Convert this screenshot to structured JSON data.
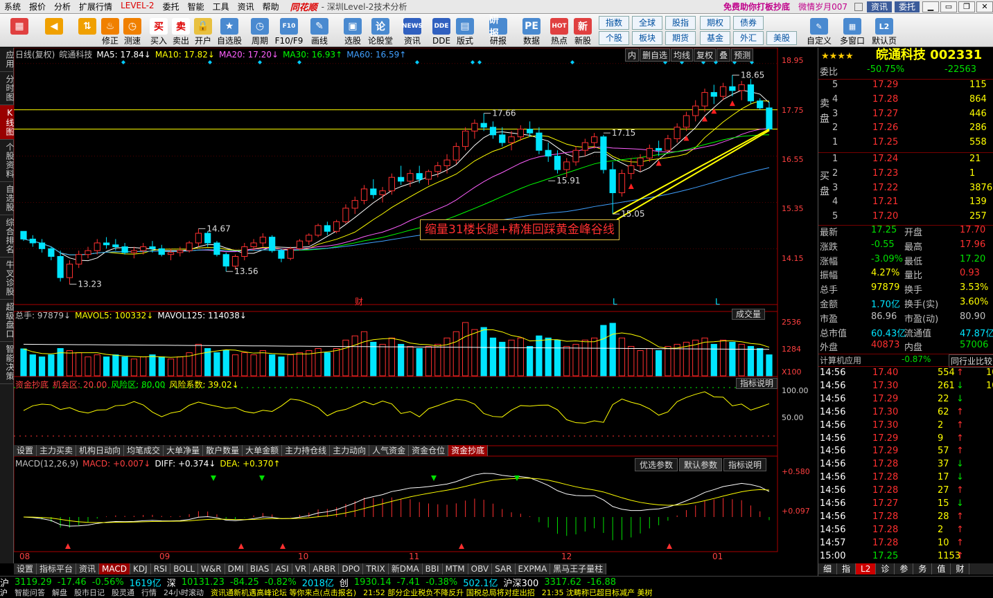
{
  "menu": {
    "items": [
      "系统",
      "报价",
      "分析",
      "扩展行情",
      "LEVEL-2",
      "委托",
      "智能",
      "工具",
      "资讯",
      "帮助"
    ],
    "logo": "同花顺",
    "title": "- 深圳Level-2技术分析",
    "promo": "免费助你打板抄底",
    "user": "微情岁月007",
    "buttons": [
      "资讯",
      "委托"
    ],
    "win": [
      "▁",
      "▭",
      "❐",
      "✕"
    ]
  },
  "toolbar": {
    "buttons": [
      {
        "label": "",
        "icon": "▦"
      },
      {
        "label": "",
        "icon": "◀"
      },
      {
        "label": "",
        "icon": "⇅"
      },
      {
        "label": "修正",
        "icon": "♨"
      },
      {
        "label": "测速",
        "icon": "◷"
      },
      {
        "label": "买入",
        "icon": "买"
      },
      {
        "label": "卖出",
        "icon": "卖"
      },
      {
        "label": "开户",
        "icon": "🔒"
      },
      {
        "label": "自选股",
        "icon": "★"
      },
      {
        "label": "周期",
        "icon": "◷"
      },
      {
        "label": "F10/F9",
        "icon": "F10"
      },
      {
        "label": "画线",
        "icon": "✎"
      },
      {
        "label": "选股",
        "icon": "▣"
      },
      {
        "label": "论股堂",
        "icon": "论"
      },
      {
        "label": "资讯",
        "icon": "NEWS"
      },
      {
        "label": "DDE",
        "icon": "DDE"
      },
      {
        "label": "版式",
        "icon": "▤"
      },
      {
        "label": "研报",
        "icon": "研报"
      },
      {
        "label": "数据",
        "icon": "PE"
      },
      {
        "label": "热点",
        "icon": "HOT"
      },
      {
        "label": "新股",
        "icon": "新"
      }
    ],
    "grid": [
      "指数",
      "全球",
      "股指",
      "期权",
      "债券",
      "个股",
      "板块",
      "期货",
      "基金",
      "外汇",
      "美股"
    ],
    "right": [
      {
        "label": "自定义",
        "icon": "✎"
      },
      {
        "label": "多窗口",
        "icon": "▦"
      },
      {
        "label": "默认页",
        "icon": "L2"
      }
    ]
  },
  "leftstrip": [
    "应用",
    "分时图",
    "K线图",
    "个股资料",
    "自选股",
    "综合排名",
    "牛叉诊股",
    "超级盘口",
    "智能决策"
  ],
  "kline": {
    "header": [
      {
        "text": "日线(复权)",
        "color": "#c0c0c0"
      },
      {
        "text": "皖通科技",
        "color": "#c0c0c0"
      },
      {
        "text": "MA5: 17.84↓",
        "color": "#ffffff"
      },
      {
        "text": "MA10: 17.82↓",
        "color": "#ffff00"
      },
      {
        "text": "MA20: 17.20↓",
        "color": "#ff60ff"
      },
      {
        "text": "MA30: 16.93↑",
        "color": "#00ff00"
      },
      {
        "text": "MA60: 16.59↑",
        "color": "#40a0ff"
      }
    ],
    "topbtns": [
      "内",
      "删自选",
      "均线",
      "复权",
      "叠",
      "预测"
    ],
    "yticks": [
      "18.95",
      "17.75",
      "16.55",
      "15.35",
      "14.15"
    ],
    "annotation": "缩量31楼长腿+精准回踩黄金峰谷线",
    "price_labels": [
      "18.65",
      "17.66",
      "17.15",
      "15.91",
      "15.05",
      "14.67",
      "13.56",
      "13.23"
    ],
    "markers": [
      "财",
      "L",
      "L"
    ]
  },
  "volume": {
    "header": [
      {
        "text": "总手: 97879↓",
        "color": "#c0c0c0"
      },
      {
        "text": "MAVOL5: 100332↓",
        "color": "#ffff00"
      },
      {
        "text": "MAVOL125: 114038↓",
        "color": "#ffffff"
      }
    ],
    "btn": "成交量",
    "yticks": [
      "2536",
      "1284",
      "X100"
    ]
  },
  "ind": {
    "header": [
      {
        "text": "资金抄底",
        "color": "#ff4040"
      },
      {
        "text": "机会区: 20.00",
        "color": "#ff4040"
      },
      {
        "text": "风险区: 80.00",
        "color": "#00ff00"
      },
      {
        "text": "风险系数: 39.02↓",
        "color": "#ffff00"
      }
    ],
    "btn": "指标说明",
    "yticks": [
      "100.00",
      "50.00"
    ]
  },
  "tabs1": [
    "设置",
    "主力买卖",
    "机构日动向",
    "均笔成交",
    "大单净量",
    "散户数量",
    "大单金额",
    "主力持仓线",
    "主力动向",
    "人气资金",
    "资金仓位",
    "资金抄底"
  ],
  "macd": {
    "header": [
      {
        "text": "MACD(12,26,9)",
        "color": "#c0c0c0"
      },
      {
        "text": "MACD: +0.007↓",
        "color": "#ff4040"
      },
      {
        "text": "DIFF: +0.374↓",
        "color": "#ffffff"
      },
      {
        "text": "DEA: +0.370↑",
        "color": "#ffff00"
      }
    ],
    "btns": [
      "优选参数",
      "默认参数",
      "指标说明"
    ],
    "yticks": [
      "+0.580",
      "+0.097"
    ]
  },
  "xaxis": [
    "08",
    "09",
    "10",
    "11",
    "12",
    "01"
  ],
  "tabs2": [
    "设置",
    "指标平台",
    "资讯",
    "MACD",
    "KDJ",
    "RSI",
    "BOLL",
    "W&R",
    "DMI",
    "BIAS",
    "ASI",
    "VR",
    "ARBR",
    "DPO",
    "TRIX",
    "新DMA",
    "BBI",
    "MTM",
    "OBV",
    "SAR",
    "EXPMA",
    "黑马王子量柱"
  ],
  "status": [
    {
      "t": "沪",
      "c": "#fff"
    },
    {
      "t": "3119.29",
      "c": "#00e000"
    },
    {
      "t": "-17.46",
      "c": "#00e000"
    },
    {
      "t": "-0.56%",
      "c": "#00e000"
    },
    {
      "t": "1619亿",
      "c": "#00e5ff"
    },
    {
      "t": "深",
      "c": "#fff"
    },
    {
      "t": "10131.23",
      "c": "#00e000"
    },
    {
      "t": "-84.25",
      "c": "#00e000"
    },
    {
      "t": "-0.82%",
      "c": "#00e000"
    },
    {
      "t": "2018亿",
      "c": "#00e5ff"
    },
    {
      "t": "创",
      "c": "#fff"
    },
    {
      "t": "1930.14",
      "c": "#00e000"
    },
    {
      "t": "-7.41",
      "c": "#00e000"
    },
    {
      "t": "-0.38%",
      "c": "#00e000"
    },
    {
      "t": "502.1亿",
      "c": "#00e5ff"
    },
    {
      "t": "沪深300",
      "c": "#fff"
    },
    {
      "t": "3317.62",
      "c": "#00e000"
    },
    {
      "t": "-16.88",
      "c": "#00e000"
    }
  ],
  "news": [
    {
      "t": "沪",
      "c": "#fff"
    },
    {
      "t": "智能问答",
      "c": "#ccc"
    },
    {
      "t": "解盘",
      "c": "#ccc"
    },
    {
      "t": "股市日记",
      "c": "#ccc"
    },
    {
      "t": "股灵通",
      "c": "#ccc"
    },
    {
      "t": "行情",
      "c": "#ccc"
    },
    {
      "t": "24小时滚动",
      "c": "#ccc"
    },
    {
      "t": "资讯通新机遇高峰论坛 等你来点(点击报名)",
      "c": "#ffff00"
    },
    {
      "t": "21:52 部分企业税负不降反升 国税总局将对症出招",
      "c": "#ffff00"
    },
    {
      "t": "21:35 沈畴称已超目标减产 美树",
      "c": "#ffff00"
    }
  ],
  "right": {
    "title": "皖通科技 002331",
    "stars": "★★★★",
    "weibi": {
      "label": "委比",
      "val": "-50.75%",
      "diff": "-22563"
    },
    "sell_label": "卖盘",
    "buy_label": "买盘",
    "sell": [
      {
        "n": "5",
        "p": "17.29",
        "v": "115"
      },
      {
        "n": "4",
        "p": "17.28",
        "v": "864"
      },
      {
        "n": "3",
        "p": "17.27",
        "v": "446"
      },
      {
        "n": "2",
        "p": "17.26",
        "v": "286"
      },
      {
        "n": "1",
        "p": "17.25",
        "v": "558"
      }
    ],
    "buy": [
      {
        "n": "1",
        "p": "17.24",
        "v": "21"
      },
      {
        "n": "2",
        "p": "17.23",
        "v": "1"
      },
      {
        "n": "3",
        "p": "17.22",
        "v": "3876"
      },
      {
        "n": "4",
        "p": "17.21",
        "v": "139"
      },
      {
        "n": "5",
        "p": "17.20",
        "v": "257"
      }
    ],
    "stats": [
      {
        "l": "最新",
        "v": "17.25",
        "vc": "#00e000",
        "l2": "开盘",
        "v2": "17.70",
        "v2c": "#ff3030"
      },
      {
        "l": "涨跌",
        "v": "-0.55",
        "vc": "#00e000",
        "l2": "最高",
        "v2": "17.96",
        "v2c": "#ff3030"
      },
      {
        "l": "涨幅",
        "v": "-3.09%",
        "vc": "#00e000",
        "l2": "最低",
        "v2": "17.20",
        "v2c": "#00e000"
      },
      {
        "l": "振幅",
        "v": "4.27%",
        "vc": "#ffff00",
        "l2": "量比",
        "v2": "0.93",
        "v2c": "#ff3030"
      },
      {
        "l": "总手",
        "v": "97879",
        "vc": "#ffff00",
        "l2": "换手",
        "v2": "3.53%",
        "v2c": "#ffff00"
      },
      {
        "l": "金额",
        "v": "1.70亿",
        "vc": "#00e5ff",
        "l2": "换手(实)",
        "v2": "3.60%",
        "v2c": "#ffff00"
      },
      {
        "l": "市盈",
        "v": "86.96",
        "vc": "#c0c0c0",
        "l2": "市盈(动)",
        "v2": "80.90",
        "v2c": "#c0c0c0"
      },
      {
        "l": "总市值",
        "v": "60.43亿",
        "vc": "#00e5ff",
        "l2": "流通值",
        "v2": "47.87亿",
        "v2c": "#00e5ff"
      },
      {
        "l": "外盘",
        "v": "40873",
        "vc": "#ff3030",
        "l2": "内盘",
        "v2": "57006",
        "v2c": "#00e000"
      }
    ],
    "industry": {
      "name": "计算机应用",
      "chg": "-0.87%",
      "btn": "同行业比较"
    },
    "ticks": [
      {
        "t": "14:56",
        "p": "17.40",
        "pc": "#ff3030",
        "v": "554",
        "d": "↑",
        "dc": "#ff3030",
        "x": "10"
      },
      {
        "t": "14:56",
        "p": "17.30",
        "pc": "#ff3030",
        "v": "261",
        "d": "↓",
        "dc": "#00e000",
        "x": "10"
      },
      {
        "t": "14:56",
        "p": "17.29",
        "pc": "#ff3030",
        "v": "22",
        "d": "↓",
        "dc": "#00e000",
        "x": ""
      },
      {
        "t": "14:56",
        "p": "17.30",
        "pc": "#ff3030",
        "v": "62",
        "d": "↑",
        "dc": "#ff3030",
        "x": ""
      },
      {
        "t": "14:56",
        "p": "17.30",
        "pc": "#ff3030",
        "v": "2",
        "d": "↑",
        "dc": "#ff3030",
        "x": ""
      },
      {
        "t": "14:56",
        "p": "17.29",
        "pc": "#ff3030",
        "v": "9",
        "d": "↑",
        "dc": "#ff3030",
        "x": ""
      },
      {
        "t": "14:56",
        "p": "17.29",
        "pc": "#ff3030",
        "v": "57",
        "d": "↑",
        "dc": "#ff3030",
        "x": ""
      },
      {
        "t": "14:56",
        "p": "17.28",
        "pc": "#ff3030",
        "v": "37",
        "d": "↓",
        "dc": "#00e000",
        "x": ""
      },
      {
        "t": "14:56",
        "p": "17.28",
        "pc": "#ff3030",
        "v": "17",
        "d": "↓",
        "dc": "#00e000",
        "x": ""
      },
      {
        "t": "14:56",
        "p": "17.28",
        "pc": "#ff3030",
        "v": "27",
        "d": "↑",
        "dc": "#ff3030",
        "x": ""
      },
      {
        "t": "14:56",
        "p": "17.27",
        "pc": "#ff3030",
        "v": "15",
        "d": "↓",
        "dc": "#00e000",
        "x": ""
      },
      {
        "t": "14:56",
        "p": "17.28",
        "pc": "#ff3030",
        "v": "28",
        "d": "↑",
        "dc": "#ff3030",
        "x": ""
      },
      {
        "t": "14:56",
        "p": "17.28",
        "pc": "#ff3030",
        "v": "2",
        "d": "↑",
        "dc": "#ff3030",
        "x": ""
      },
      {
        "t": "14:57",
        "p": "17.28",
        "pc": "#ff3030",
        "v": "10",
        "d": "↑",
        "dc": "#ff3030",
        "x": ""
      },
      {
        "t": "15:00",
        "p": "17.25",
        "pc": "#00e000",
        "v": "1153",
        "d": "↑",
        "dc": "#ff3030",
        "x": ""
      }
    ],
    "bottomtabs": [
      "细",
      "指",
      "L2",
      "诊",
      "参",
      "务",
      "值",
      "财"
    ]
  },
  "chart_data": {
    "type": "candlestick",
    "title": "皖通科技 日线(复权)",
    "ylim": [
      12.9,
      19.0
    ],
    "x": [
      "08",
      "09",
      "10",
      "11",
      "12",
      "01"
    ],
    "ohlc": [
      [
        14.6,
        14.55,
        14.35,
        14.4
      ],
      [
        14.4,
        14.5,
        14.2,
        14.3
      ],
      [
        14.3,
        14.4,
        14.05,
        14.15
      ],
      [
        14.15,
        14.2,
        13.85,
        13.95
      ],
      [
        13.95,
        14.1,
        13.3,
        13.4
      ],
      [
        13.4,
        13.85,
        13.23,
        13.75
      ],
      [
        13.75,
        14.1,
        13.65,
        14.0
      ],
      [
        14.0,
        14.2,
        13.9,
        14.1
      ],
      [
        14.1,
        14.4,
        14.0,
        14.3
      ],
      [
        14.3,
        14.45,
        14.15,
        14.25
      ],
      [
        14.25,
        14.4,
        14.1,
        14.2
      ],
      [
        14.2,
        14.3,
        14.0,
        14.05
      ],
      [
        14.05,
        14.2,
        13.9,
        14.1
      ],
      [
        14.1,
        14.3,
        14.0,
        14.2
      ],
      [
        14.2,
        14.35,
        14.05,
        14.15
      ],
      [
        14.15,
        14.25,
        13.95,
        14.0
      ],
      [
        14.0,
        14.15,
        13.85,
        14.05
      ],
      [
        14.05,
        14.2,
        13.95,
        14.1
      ],
      [
        14.1,
        14.35,
        14.05,
        14.3
      ],
      [
        14.3,
        14.67,
        14.2,
        14.55
      ],
      [
        14.55,
        14.6,
        14.2,
        14.3
      ],
      [
        14.3,
        14.35,
        13.95,
        14.0
      ],
      [
        14.0,
        14.05,
        13.56,
        13.7
      ],
      [
        13.7,
        14.0,
        13.6,
        13.95
      ],
      [
        13.95,
        14.3,
        13.85,
        14.2
      ],
      [
        14.2,
        14.4,
        14.1,
        14.3
      ],
      [
        14.3,
        14.55,
        14.2,
        14.45
      ],
      [
        14.45,
        14.5,
        14.05,
        14.1
      ],
      [
        14.1,
        14.15,
        13.8,
        13.9
      ],
      [
        13.9,
        14.2,
        13.85,
        14.15
      ],
      [
        14.15,
        14.4,
        14.1,
        14.35
      ],
      [
        14.35,
        14.55,
        14.25,
        14.5
      ],
      [
        14.5,
        14.8,
        14.45,
        14.75
      ],
      [
        14.75,
        14.85,
        14.5,
        14.6
      ],
      [
        14.6,
        14.9,
        14.55,
        14.85
      ],
      [
        14.85,
        15.3,
        14.8,
        15.2
      ],
      [
        15.2,
        15.5,
        15.05,
        15.4
      ],
      [
        15.4,
        15.8,
        15.3,
        15.7
      ],
      [
        15.7,
        15.95,
        15.45,
        15.55
      ],
      [
        15.55,
        15.75,
        15.35,
        15.65
      ],
      [
        15.65,
        16.1,
        15.55,
        16.0
      ],
      [
        16.0,
        16.3,
        15.8,
        15.9
      ],
      [
        15.9,
        16.2,
        15.75,
        16.1
      ],
      [
        16.1,
        16.3,
        15.85,
        15.95
      ],
      [
        15.95,
        16.2,
        15.8,
        16.15
      ],
      [
        16.15,
        16.4,
        16.0,
        16.3
      ],
      [
        16.3,
        16.6,
        16.1,
        16.45
      ],
      [
        16.45,
        16.9,
        16.35,
        16.8
      ],
      [
        16.8,
        17.3,
        16.7,
        17.2
      ],
      [
        17.2,
        17.5,
        17.0,
        17.4
      ],
      [
        17.4,
        17.66,
        17.2,
        17.3
      ],
      [
        17.3,
        17.45,
        17.0,
        17.1
      ],
      [
        17.1,
        17.3,
        16.8,
        16.9
      ],
      [
        16.9,
        17.2,
        16.7,
        17.05
      ],
      [
        17.05,
        17.35,
        16.95,
        17.25
      ],
      [
        17.25,
        17.45,
        17.05,
        17.15
      ],
      [
        17.15,
        17.3,
        16.6,
        16.7
      ],
      [
        16.7,
        16.9,
        16.4,
        16.55
      ],
      [
        16.55,
        16.7,
        16.1,
        16.2
      ],
      [
        16.2,
        16.5,
        16.0,
        16.4
      ],
      [
        16.4,
        16.8,
        16.3,
        16.7
      ],
      [
        16.7,
        17.0,
        16.55,
        16.9
      ],
      [
        16.9,
        17.15,
        16.75,
        17.05
      ],
      [
        17.05,
        17.1,
        16.1,
        16.2
      ],
      [
        16.2,
        16.4,
        15.05,
        15.6
      ],
      [
        15.6,
        16.2,
        15.5,
        16.1
      ],
      [
        16.1,
        16.5,
        15.95,
        16.3
      ],
      [
        16.3,
        16.6,
        16.15,
        16.5
      ],
      [
        16.5,
        16.85,
        16.4,
        16.75
      ],
      [
        16.75,
        16.95,
        16.55,
        16.7
      ],
      [
        16.7,
        17.1,
        16.65,
        17.0
      ],
      [
        17.0,
        17.4,
        16.9,
        17.3
      ],
      [
        17.3,
        17.7,
        17.2,
        17.6
      ],
      [
        17.6,
        18.0,
        17.45,
        17.85
      ],
      [
        17.85,
        18.3,
        17.7,
        18.2
      ],
      [
        18.2,
        18.4,
        17.9,
        18.1
      ],
      [
        18.1,
        18.45,
        18.0,
        18.35
      ],
      [
        18.35,
        18.65,
        18.1,
        18.25
      ],
      [
        18.25,
        18.5,
        18.0,
        18.4
      ],
      [
        18.4,
        18.55,
        17.9,
        17.98
      ],
      [
        17.98,
        18.05,
        17.75,
        17.8
      ],
      [
        17.8,
        17.96,
        17.2,
        17.25
      ]
    ],
    "volume": [
      1284,
      1000,
      900,
      1000,
      1300,
      1200,
      1100,
      900,
      1000,
      900,
      1000,
      900,
      800,
      900,
      1000,
      900,
      800,
      900,
      1100,
      1500,
      1300,
      1100,
      1200,
      1000,
      1100,
      1000,
      1200,
      1000,
      900,
      1000,
      1100,
      1200,
      1300,
      1100,
      1300,
      1700,
      1900,
      2100,
      1600,
      1500,
      1800,
      1500,
      1400,
      1300,
      1400,
      1500,
      1800,
      2100,
      2536,
      2200,
      2300,
      1800,
      1600,
      1700,
      1800,
      1400,
      1900,
      1800,
      1700,
      1400,
      1500,
      1700,
      1800,
      2400,
      2500,
      1800,
      1400,
      1200,
      1300,
      1200,
      1400,
      1500,
      1600,
      1700,
      1800,
      1500,
      1700,
      1600,
      1500,
      1400,
      1300,
      1000
    ],
    "series": [
      {
        "name": "MA5"
      },
      {
        "name": "MA10"
      },
      {
        "name": "MA20"
      },
      {
        "name": "MA30"
      },
      {
        "name": "MA60"
      },
      {
        "name": "MAVOL5"
      },
      {
        "name": "MAVOL125"
      },
      {
        "name": "资金抄底"
      },
      {
        "name": "DIFF"
      },
      {
        "name": "DEA"
      },
      {
        "name": "MACD"
      }
    ]
  }
}
